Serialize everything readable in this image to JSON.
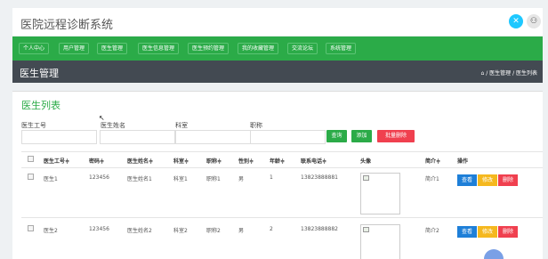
{
  "app": {
    "title": "医院远程诊断系统",
    "icon1": "theme-icon",
    "icon2": "user-icon"
  },
  "nav": [
    "个人中心",
    "用户管理",
    "医生管理",
    "医生信息管理",
    "医生预约管理",
    "我的收藏管理",
    "交流论坛",
    "系统管理"
  ],
  "header": {
    "title": "医生管理",
    "breadcrumb": "⌂ / 医生管理 / 医生列表"
  },
  "list": {
    "title": "医生列表"
  },
  "filters": {
    "doc_id": "医生工号",
    "doc_name": "医生姓名",
    "dept": "科室",
    "title": "职称"
  },
  "buttons": {
    "search": "查询",
    "add": "添加",
    "batch_delete": "批量删除"
  },
  "columns": [
    "医生工号≑",
    "密码≑",
    "医生姓名≑",
    "科室≑",
    "职称≑",
    "性别≑",
    "年龄≑",
    "联系电话≑",
    "头像",
    "简介≑",
    "操作"
  ],
  "rows": [
    {
      "doc_id": "医生1",
      "password": "123456",
      "name": "医生姓名1",
      "dept": "科室1",
      "title": "职称1",
      "gender": "男",
      "age": "1",
      "phone": "13823888881",
      "intro": "简介1"
    },
    {
      "doc_id": "医生2",
      "password": "123456",
      "name": "医生姓名2",
      "dept": "科室2",
      "title": "职称2",
      "gender": "男",
      "age": "2",
      "phone": "13823888882",
      "intro": "简介2"
    }
  ],
  "row_actions": {
    "view": "查看",
    "edit": "修改",
    "delete": "删除"
  },
  "colors": {
    "green": "#2bab48",
    "dark": "#434a52",
    "blue": "#1e7fd8",
    "yellow": "#f5b81e",
    "red": "#f0404f"
  }
}
